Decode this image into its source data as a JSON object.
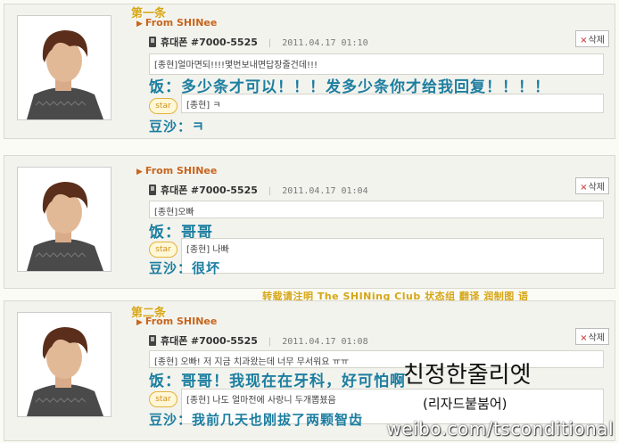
{
  "colors": {
    "accent": "#c8651c",
    "handwriting": "#1c7ea0",
    "badge": "#d6a615"
  },
  "cards": [
    {
      "badge": "第一条",
      "from": "From SHINee",
      "sender_name": "휴대폰",
      "sender_number": "#7000-5525",
      "timestamp": "2011.04.17 01:10",
      "delete_label": "삭제",
      "message": "[종현]얼마면되!!!!몇번보내면답장줄건데!!!",
      "translation": "饭：多少条才可以！！！发多少条你才给我回复！！！！",
      "star_label": "star",
      "reply": "[종현] ㅋ",
      "reply_translation": "豆沙：ㅋ"
    },
    {
      "badge": "",
      "from": "From SHINee",
      "sender_name": "휴대폰",
      "sender_number": "#7000-5525",
      "timestamp": "2011.04.17 01:04",
      "delete_label": "삭제",
      "message": "[종현]오빠",
      "translation": "饭：哥哥",
      "star_label": "star",
      "reply": "[종현] 나빠",
      "reply_translation": "豆沙：很坏"
    },
    {
      "badge": "第二条",
      "from": "From SHINee",
      "sender_name": "휴대폰",
      "sender_number": "#7000-5525",
      "timestamp": "2011.04.17 01:08",
      "delete_label": "삭제",
      "message": "[종현] 오빠! 저 지금 치과왔는데 너무 무서워요 ㅠㅠ",
      "translation": "饭：哥哥！我现在在牙科，好可怕啊",
      "star_label": "star",
      "reply": "[종현] 나도 얼마전에 사랑니 두개뽑뵸음",
      "reply_translation": "豆沙：我前几天也刚拔了两颗智齿"
    }
  ],
  "credit": "转载请注明 The SHINing Club 状态组 翻译 润制图 语",
  "korean_note": "친정한줄리엣",
  "korean_subnote": "(리자드붙붐어)",
  "watermark": "weibo.com/tsconditional"
}
